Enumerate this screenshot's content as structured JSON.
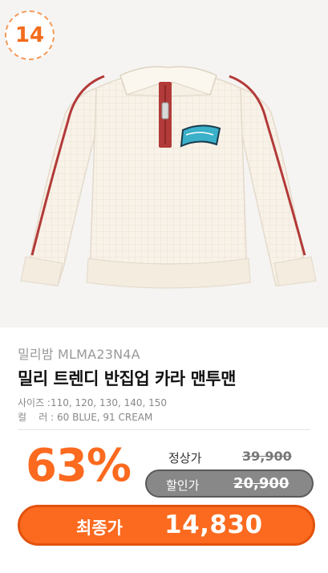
{
  "rank": "14",
  "product": {
    "brand_line": "밀리밤 MLMA23N4A",
    "title": "밀리 트렌디 반집업 카라 맨투맨",
    "size_label": "사이즈 : ",
    "size_value": "110, 120, 130, 140, 150",
    "color_label": "컬    러 : ",
    "color_value": "60 BLUE, 91 CREAM"
  },
  "pricing": {
    "discount_rate": "63%",
    "regular_label": "정상가",
    "regular_price": "39,900",
    "sale_label": "할인가",
    "sale_price": "20,900",
    "final_label": "최종가",
    "final_price": "14,830"
  },
  "colors": {
    "accent": "#fb6a1f",
    "sweater": "#f7f1e6",
    "trim": "#b23a38",
    "gray_pill": "#888888"
  }
}
